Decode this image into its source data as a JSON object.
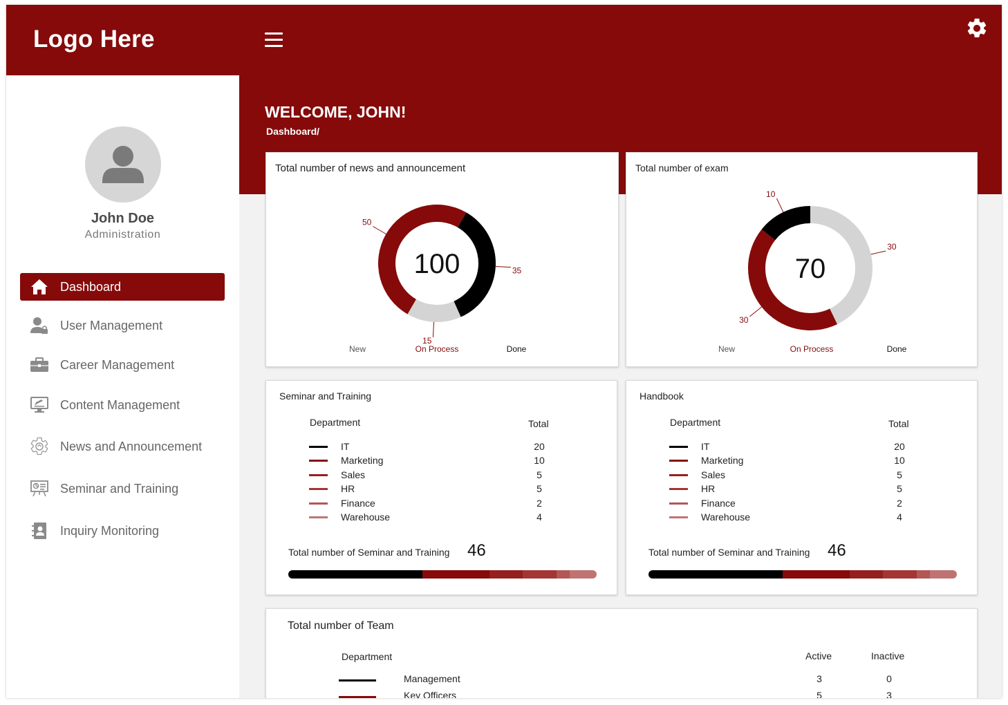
{
  "app": {
    "logo": "Logo Here"
  },
  "profile": {
    "name": "John Doe",
    "role": "Administration"
  },
  "sidebar": {
    "items": [
      {
        "label": "Dashboard",
        "icon": "home-icon",
        "active": true
      },
      {
        "label": "User Management",
        "icon": "user-lock-icon"
      },
      {
        "label": "Career Management",
        "icon": "briefcase-icon"
      },
      {
        "label": "Content Management",
        "icon": "monitor-edit-icon"
      },
      {
        "label": "News and Announcement",
        "icon": "gear-news-icon"
      },
      {
        "label": "Seminar and Training",
        "icon": "presentation-board-icon"
      },
      {
        "label": "Inquiry Monitoring",
        "icon": "contact-book-icon"
      }
    ]
  },
  "header": {
    "welcome": "WELCOME, JOHN!",
    "breadcrumb": "Dashboard/"
  },
  "news_card": {
    "title": "Total number of news and announcement",
    "total": "100",
    "labels": {
      "new": "New",
      "on_process": "On Process",
      "done": "Done"
    }
  },
  "exam_card": {
    "title": "Total number of exam",
    "total": "70",
    "labels": {
      "new": "New",
      "on_process": "On Process",
      "done": "Done"
    }
  },
  "seminar_card": {
    "title": "Seminar and Training",
    "col_department": "Department",
    "col_total": "Total",
    "rows": [
      {
        "name": "IT",
        "value": "20"
      },
      {
        "name": "Marketing",
        "value": "10"
      },
      {
        "name": "Sales",
        "value": "5"
      },
      {
        "name": "HR",
        "value": "5"
      },
      {
        "name": "Finance",
        "value": "2"
      },
      {
        "name": "Warehouse",
        "value": "4"
      }
    ],
    "total_label": "Total number of Seminar and Training",
    "total_value": "46"
  },
  "handbook_card": {
    "title": "Handbook",
    "col_department": "Department",
    "col_total": "Total",
    "rows": [
      {
        "name": "IT",
        "value": "20"
      },
      {
        "name": "Marketing",
        "value": "10"
      },
      {
        "name": "Sales",
        "value": "5"
      },
      {
        "name": "HR",
        "value": "5"
      },
      {
        "name": "Finance",
        "value": "2"
      },
      {
        "name": "Warehouse",
        "value": "4"
      }
    ],
    "total_label": "Total number of Seminar and Training",
    "total_value": "46"
  },
  "team_card": {
    "title": "Total number of Team",
    "col_department": "Department",
    "col_active": "Active",
    "col_inactive": "Inactive",
    "rows": [
      {
        "name": "Management",
        "active": "3",
        "inactive": "0"
      },
      {
        "name": "Key Officers",
        "active": "5",
        "inactive": "3"
      }
    ]
  },
  "colors": {
    "brand": "#860a0a",
    "black": "#000000",
    "light_gray": "#d4d4d4",
    "very_light_gray": "#f2f2f2",
    "dept_colors": [
      "#000000",
      "#860a0a",
      "#951f1f",
      "#a33535",
      "#b35656",
      "#bf7373"
    ]
  },
  "chart_data": [
    {
      "type": "pie",
      "title": "Total number of news and announcement",
      "center_label": "100",
      "slices": [
        {
          "label": "New",
          "value": 15,
          "color": "#d4d4d4"
        },
        {
          "label": "On Process",
          "value": 50,
          "color": "#860a0a"
        },
        {
          "label": "Done",
          "value": 35,
          "color": "#000000"
        }
      ]
    },
    {
      "type": "pie",
      "title": "Total number of exam",
      "center_label": "70",
      "slices": [
        {
          "label": "New",
          "value": 30,
          "color": "#d4d4d4"
        },
        {
          "label": "On Process",
          "value": 30,
          "color": "#860a0a"
        },
        {
          "label": "Done",
          "value": 10,
          "color": "#000000"
        }
      ]
    }
  ]
}
